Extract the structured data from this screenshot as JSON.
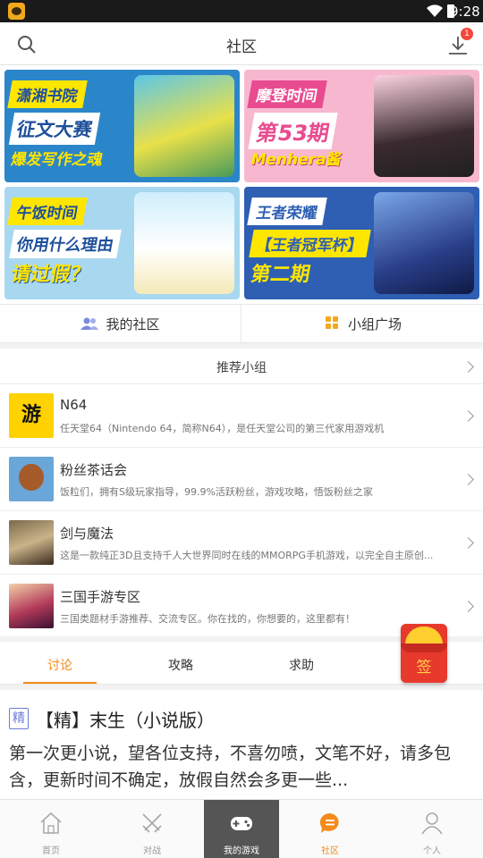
{
  "status_bar": {
    "time": "9:28"
  },
  "header": {
    "title": "社区",
    "download_badge": "1"
  },
  "banners": [
    {
      "tag": "潇湘书院",
      "line1": "征文大赛",
      "line2": "爆发写作之魂"
    },
    {
      "tag": "摩登时间",
      "line1": "第53期",
      "line2": "Menhera酱"
    },
    {
      "tag": "午饭时间",
      "line1": "你用什么理由",
      "line2": "请过假？"
    },
    {
      "tag": "王者荣耀",
      "line1": "【王者冠军杯】",
      "line2": "第二期"
    }
  ],
  "community_buttons": {
    "my_community": "我的社区",
    "group_square": "小组广场"
  },
  "recommended": {
    "title": "推荐小组",
    "groups": [
      {
        "thumb_text": "游",
        "name": "N64",
        "desc": "任天堂64（Nintendo 64，简称N64），是任天堂公司的第三代家用游戏机"
      },
      {
        "thumb_text": "",
        "name": "粉丝茶话会",
        "desc": "饭粒们，拥有S级玩家指导，99.9%活跃粉丝，游戏攻略，悟饭粉丝之家"
      },
      {
        "thumb_text": "",
        "name": "剑与魔法",
        "desc": "这是一款纯正3D且支持千人大世界同时在线的MMORPG手机游戏，以完全自主原创..."
      },
      {
        "thumb_text": "",
        "name": "三国手游专区",
        "desc": "三国类题材手游推荐、交流专区。你在找的，你想要的，这里都有！"
      }
    ]
  },
  "feed_tabs": [
    "讨论",
    "攻略",
    "求助"
  ],
  "envelope": {
    "label": "签"
  },
  "post": {
    "tag": "精",
    "title": "【精】末生（小说版）",
    "body": "第一次更小说，望各位支持，不喜勿喷，文笔不好，请多包含，更新时间不确定，放假自然会多更一些..."
  },
  "bottom_nav": [
    "首页",
    "对战",
    "我的游戏",
    "社区",
    "个人"
  ],
  "colors": {
    "accent": "#f38a1a",
    "badge": "#f2473a",
    "envelope": "#e8392d"
  }
}
